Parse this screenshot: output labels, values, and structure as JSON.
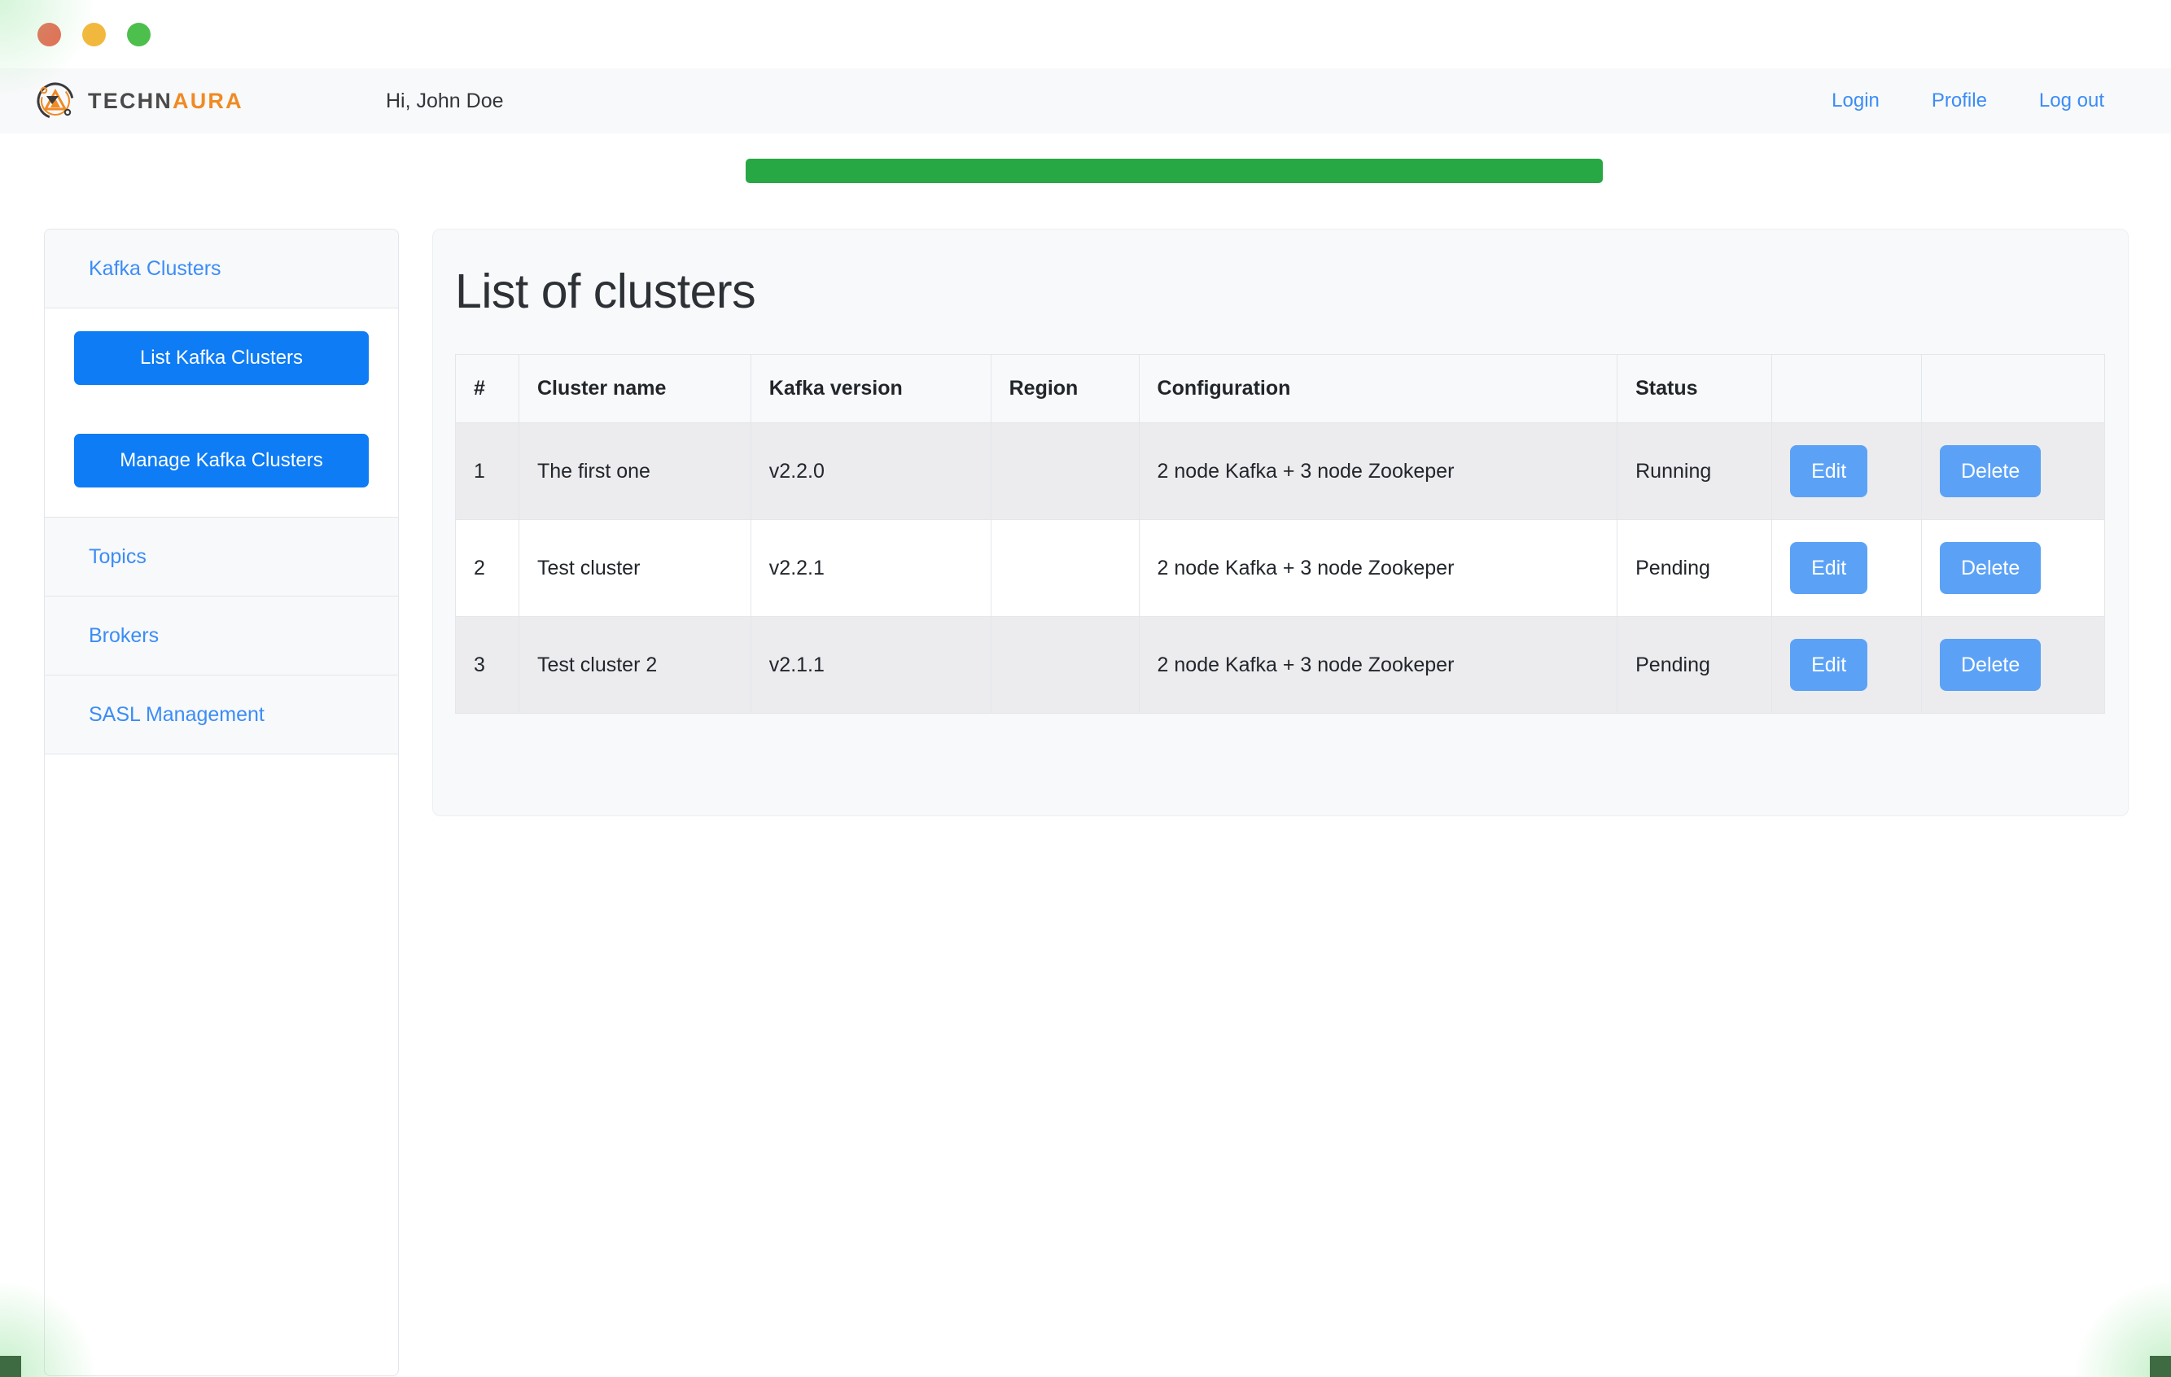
{
  "window": {
    "traffic_lights": [
      {
        "name": "close",
        "color": "#e8654f"
      },
      {
        "name": "minimize",
        "color": "#f2b83d"
      },
      {
        "name": "zoom",
        "color": "#4cbf4c"
      }
    ]
  },
  "navbar": {
    "brand": {
      "logo_icon": "technaura-logo-icon",
      "text_primary": "TECHN",
      "text_accent": "AURA"
    },
    "greeting": "Hi, John Doe",
    "progress": {
      "value": 100,
      "color": "#28a745"
    },
    "links": [
      {
        "label": "Login",
        "name": "login"
      },
      {
        "label": "Profile",
        "name": "profile"
      },
      {
        "label": "Log out",
        "name": "logout"
      }
    ]
  },
  "sidebar": {
    "items": [
      {
        "label": "Kafka Clusters",
        "name": "kafka-clusters"
      },
      {
        "label": "Topics",
        "name": "topics"
      },
      {
        "label": "Brokers",
        "name": "brokers"
      },
      {
        "label": "SASL Management",
        "name": "sasl-management"
      }
    ],
    "buttons": [
      {
        "label": "List Kafka Clusters",
        "name": "list-kafka-clusters"
      },
      {
        "label": "Manage Kafka Clusters",
        "name": "manage-kafka-clusters"
      }
    ]
  },
  "main": {
    "title": "List of clusters",
    "table": {
      "columns": [
        "#",
        "Cluster name",
        "Kafka version",
        "Region",
        "Configuration",
        "Status",
        "",
        ""
      ],
      "rows": [
        {
          "num": "1",
          "cluster_name": "The first one",
          "kafka_version": "v2.2.0",
          "region": "",
          "configuration": "2 node Kafka + 3 node Zookeper",
          "status": "Running",
          "edit_label": "Edit",
          "delete_label": "Delete"
        },
        {
          "num": "2",
          "cluster_name": "Test cluster",
          "kafka_version": "v2.2.1",
          "region": "",
          "configuration": "2 node Kafka + 3 node Zookeper",
          "status": "Pending",
          "edit_label": "Edit",
          "delete_label": "Delete"
        },
        {
          "num": "3",
          "cluster_name": "Test cluster 2",
          "kafka_version": "v2.1.1",
          "region": "",
          "configuration": "2 node Kafka + 3 node Zookeper",
          "status": "Pending",
          "edit_label": "Edit",
          "delete_label": "Delete"
        }
      ]
    }
  },
  "colors": {
    "link": "#3b8cf7",
    "primary_button": "#0d7cf5",
    "action_button": "#5ba2f7",
    "progress": "#28a745",
    "panel": "#f8f9fa",
    "border": "#e3e6ea"
  }
}
